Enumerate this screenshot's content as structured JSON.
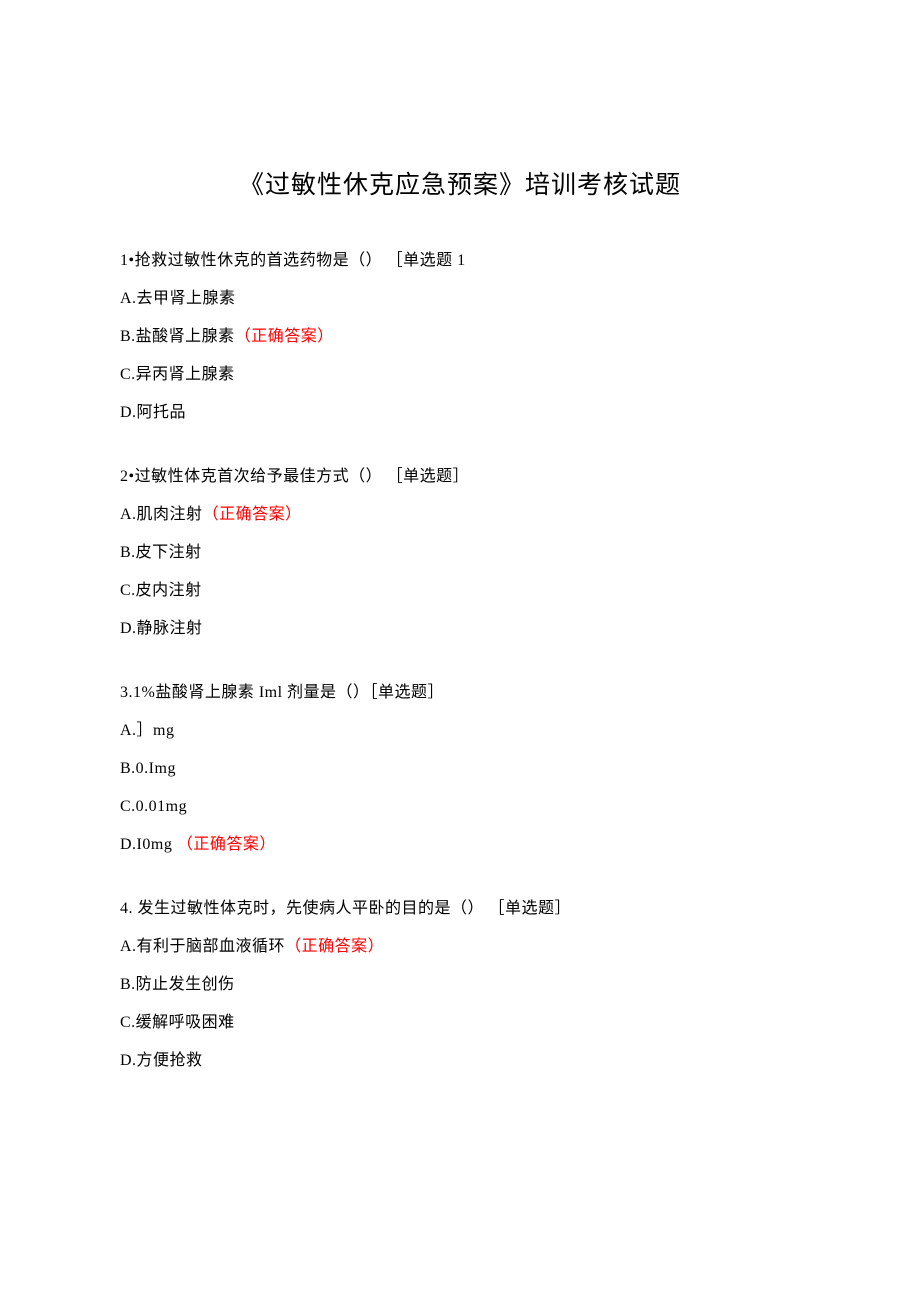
{
  "title": "《过敏性休克应急预案》培训考核试题",
  "q1": {
    "stem": "1•抢救过敏性休克的首选药物是（） ［单选题 1",
    "a": "A.去甲肾上腺素",
    "b_text": "B.盐酸肾上腺素",
    "b_correct": "（正确答案）",
    "c": "C.异丙肾上腺素",
    "d": "D.阿托品"
  },
  "q2": {
    "stem": "2•过敏性体克首次给予最佳方式（） ［单选题］",
    "a_text": "A.肌肉注射",
    "a_correct": "（正确答案）",
    "b": "B.皮下注射",
    "c": "C.皮内注射",
    "d": "D.静脉注射"
  },
  "q3": {
    "stem": "3.1%盐酸肾上腺素 Iml 剂量是（）［单选题］",
    "a": "A.］mg",
    "b": "B.0.Img",
    "c": "C.0.01mg",
    "d_text": "D.I0mg ",
    "d_correct": "（正确答案）"
  },
  "q4": {
    "stem": "4. 发生过敏性体克时，先使病人平卧的目的是（） ［单选题］",
    "a_text": "A.有利于脑部血液循环",
    "a_correct": "（正确答案）",
    "b": "B.防止发生创伤",
    "c": "C.缓解呼吸困难",
    "d": "D.方便抢救"
  }
}
